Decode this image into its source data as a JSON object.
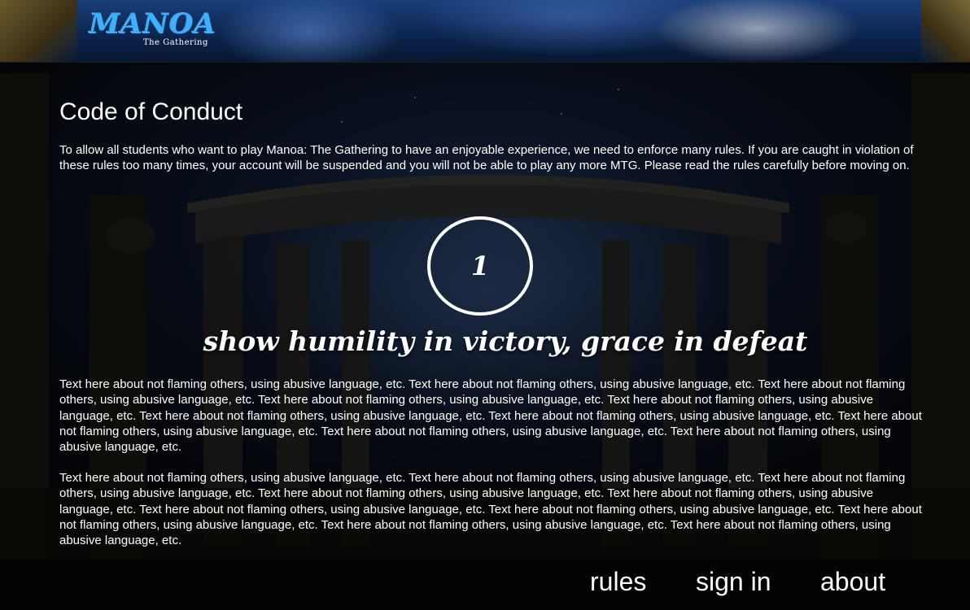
{
  "header": {
    "logo_title": "MANOA",
    "logo_subtitle": "The Gathering"
  },
  "main": {
    "title": "Code of Conduct",
    "intro": "To allow all students who want to play Manoa: The Gathering to have an enjoyable experience, we need to enforce many rules. If you are caught in violation of these rules too many times, your account will be suspended and you will not be able to play any more MTG. Please read the rules carefully before moving on.",
    "rule": {
      "number": "1",
      "heading": "show humility in victory, grace in defeat",
      "paragraphs": [
        "Text here about not flaming others, using abusive language, etc. Text here about not flaming others, using abusive language, etc. Text here about not flaming others, using abusive language, etc. Text here about not flaming others, using abusive language, etc. Text here about not flaming others, using abusive language, etc. Text here about not flaming others, using abusive language, etc. Text here about not flaming others, using abusive language, etc. Text here about not flaming others, using abusive language, etc. Text here about not flaming others, using abusive language, etc. Text here about not flaming others, using abusive language, etc.",
        "Text here about not flaming others, using abusive language, etc. Text here about not flaming others, using abusive language, etc. Text here about not flaming others, using abusive language, etc. Text here about not flaming others, using abusive language, etc. Text here about not flaming others, using abusive language, etc. Text here about not flaming others, using abusive language, etc. Text here about not flaming others, using abusive language, etc. Text here about not flaming others, using abusive language, etc. Text here about not flaming others, using abusive language, etc. Text here about not flaming others, using abusive language, etc."
      ]
    }
  },
  "footer": {
    "nav": [
      {
        "label": "rules"
      },
      {
        "label": "sign in"
      },
      {
        "label": "about"
      }
    ]
  },
  "colors": {
    "text": "#ffffff",
    "footer_bg": "#020202",
    "logo_blue": "#3fb0ff"
  }
}
